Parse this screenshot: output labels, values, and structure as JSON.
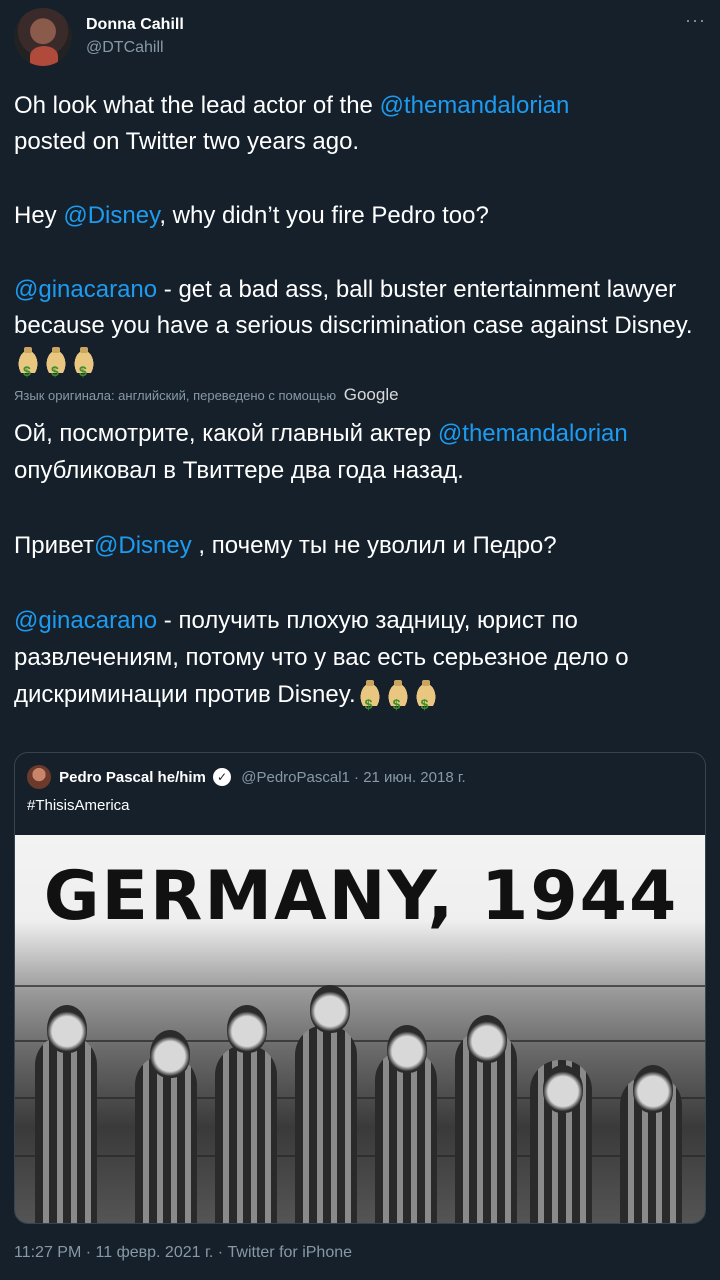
{
  "author": {
    "name": "Donna Cahill",
    "handle": "@DTCahill",
    "more_label": "···"
  },
  "original_text": {
    "line1_pre": "Oh look what the lead actor of the ",
    "line1_mention": "@themandalorian",
    "line2": "posted on Twitter two years ago.",
    "p2_pre": "Hey ",
    "p2_mention": "@Disney",
    "p2_post": ", why didn’t you fire Pedro too?",
    "p3_mention": "@ginacarano",
    "p3_text": " - get a bad ass, ball buster entertainment lawyer because you have a serious discrimination case against Disney. ",
    "emoji": "money-bag-icon"
  },
  "translation_notice": {
    "text": "Язык оригинала: английский, переведено с помощью",
    "provider": "Google"
  },
  "translated_text": {
    "p1_pre": "Ой, посмотрите, какой главный актер ",
    "p1_mention": "@themandalorian",
    "p1_post": " опубликовал в Твиттере два года назад.",
    "p2_pre": " Привет",
    "p2_mention": "@Disney",
    "p2_post": " , почему ты не уволил и Педро?",
    "p3_mention": "@ginacarano",
    "p3_text": " - получить плохую задницу, юрист по развлечениям, потому что у вас есть серьезное дело о дискриминации против Disney."
  },
  "quoted_tweet": {
    "name": "Pedro Pascal he/him",
    "verified_mark": "✓",
    "handle_date": "@PedroPascal1 · 21 июн. 2018 г.",
    "text": "#ThisisAmerica",
    "image_caption": "GERMANY, 1944"
  },
  "footer": {
    "meta": "11:27 PM · 11 февр. 2021 г. · Twitter for iPhone"
  },
  "colors": {
    "background": "#15202b",
    "link": "#1d9bf0",
    "secondary": "#8899a6"
  }
}
